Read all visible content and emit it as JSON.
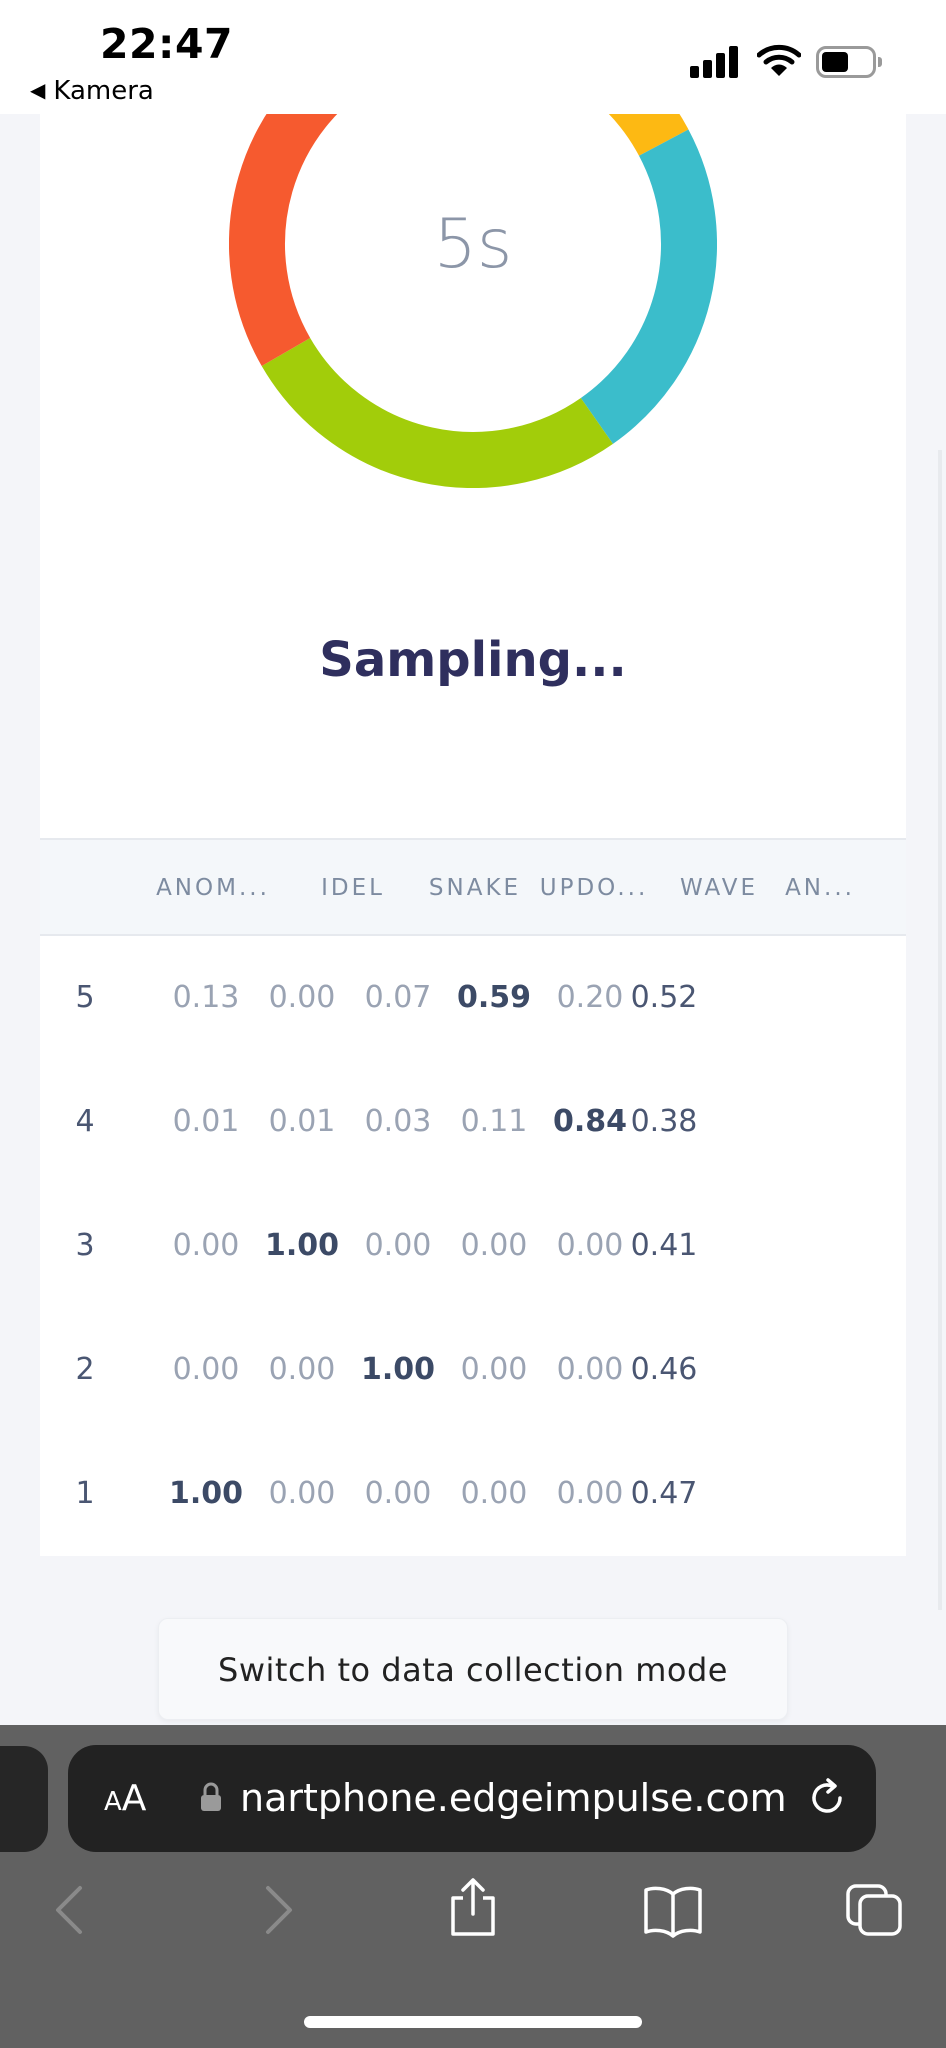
{
  "status_bar": {
    "time": "22:47",
    "back_app": "Kamera"
  },
  "progress": {
    "label": "5s"
  },
  "status_text": "Sampling...",
  "table": {
    "headers": [
      "ANOM...",
      "IDEL",
      "SNAKE",
      "UPDO...",
      "WAVE",
      "AN..."
    ],
    "rows": [
      {
        "id": "5",
        "values": [
          "0.13",
          "0.00",
          "0.07",
          "0.59",
          "0.20",
          "0.52"
        ],
        "bold_index": 3
      },
      {
        "id": "4",
        "values": [
          "0.01",
          "0.01",
          "0.03",
          "0.11",
          "0.84",
          "0.38"
        ],
        "bold_index": 4
      },
      {
        "id": "3",
        "values": [
          "0.00",
          "1.00",
          "0.00",
          "0.00",
          "0.00",
          "0.41"
        ],
        "bold_index": 1
      },
      {
        "id": "2",
        "values": [
          "0.00",
          "0.00",
          "1.00",
          "0.00",
          "0.00",
          "0.46"
        ],
        "bold_index": 2
      },
      {
        "id": "1",
        "values": [
          "1.00",
          "0.00",
          "0.00",
          "0.00",
          "0.00",
          "0.47"
        ],
        "bold_index": 0
      }
    ]
  },
  "switch_button": "Switch to data collection mode",
  "browser": {
    "aa_big": "A",
    "aa_small": "A",
    "url": "nartphone.edgeimpulse.com"
  },
  "ring_colors": {
    "red": "#f65a2f",
    "green": "#a2cd0a",
    "teal": "#3bbdcb",
    "yellow": "#fdb913"
  }
}
